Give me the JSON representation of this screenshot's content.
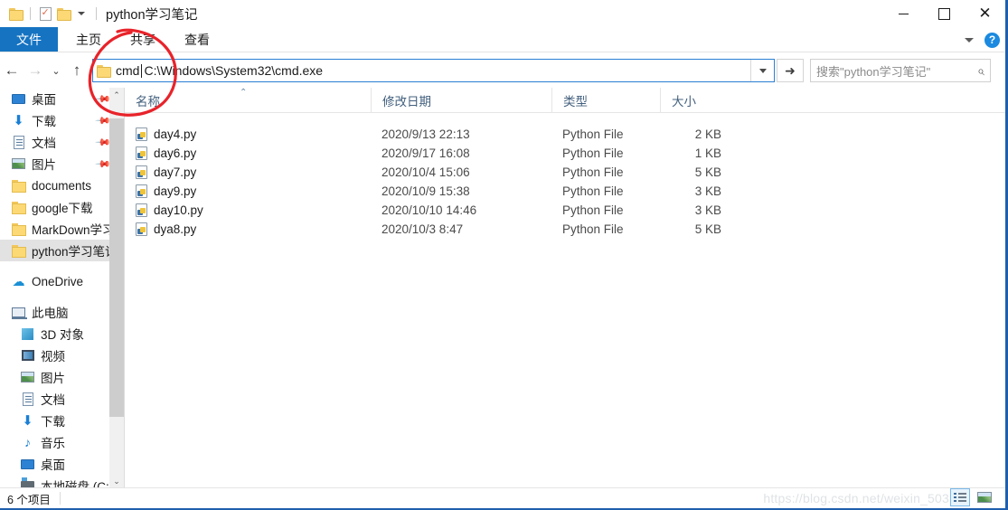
{
  "window": {
    "title": "python学习笔记",
    "quick_access": [
      {
        "name": "folder-icon",
        "label": "文件夹"
      },
      {
        "name": "properties-icon",
        "label": "属性"
      },
      {
        "name": "new-folder-icon",
        "label": "新建文件夹"
      },
      {
        "name": "chevron-down-icon",
        "label": "自定义快速访问工具栏"
      }
    ],
    "controls": {
      "minimize": "最小化",
      "maximize": "最大化",
      "close": "关闭"
    }
  },
  "ribbon": {
    "tabs": [
      {
        "label": "文件",
        "active": true
      },
      {
        "label": "主页",
        "active": false
      },
      {
        "label": "共享",
        "active": false
      },
      {
        "label": "查看",
        "active": false
      }
    ],
    "expand_label": "展开功能区",
    "help_label": "?"
  },
  "nav": {
    "back": "←",
    "forward": "→",
    "recent": "⌄",
    "up": "↑",
    "address": {
      "prefix": "cmd ",
      "value": "C:\\Windows\\System32\\cmd.exe",
      "dropdown": "⌄",
      "go": "➜"
    },
    "search": {
      "placeholder": "搜索\"python学习笔记\"",
      "icon": "⌕"
    }
  },
  "sidebar": {
    "quick_items": [
      {
        "label": "桌面",
        "icon": "desktop-icon",
        "pinned": true
      },
      {
        "label": "下载",
        "icon": "download-icon",
        "pinned": true
      },
      {
        "label": "文档",
        "icon": "document-icon",
        "pinned": true
      },
      {
        "label": "图片",
        "icon": "picture-icon",
        "pinned": true
      },
      {
        "label": "documents",
        "icon": "folder-icon",
        "pinned": false
      },
      {
        "label": "google下载",
        "icon": "folder-icon",
        "pinned": false
      },
      {
        "label": "MarkDown学习",
        "icon": "folder-icon",
        "pinned": false
      },
      {
        "label": "python学习笔记",
        "icon": "folder-icon",
        "pinned": false,
        "selected": true
      }
    ],
    "onedrive": {
      "label": "OneDrive",
      "icon": "cloud-icon"
    },
    "thispc": {
      "label": "此电脑",
      "icon": "pc-icon"
    },
    "pc_items": [
      {
        "label": "3D 对象",
        "icon": "cube-icon"
      },
      {
        "label": "视频",
        "icon": "video-icon"
      },
      {
        "label": "图片",
        "icon": "picture-icon"
      },
      {
        "label": "文档",
        "icon": "document-icon"
      },
      {
        "label": "下载",
        "icon": "download-icon"
      },
      {
        "label": "音乐",
        "icon": "music-icon"
      },
      {
        "label": "桌面",
        "icon": "desktop-icon"
      },
      {
        "label": "本地磁盘 (C:)",
        "icon": "disk-icon"
      }
    ],
    "scroll_up": "⌃",
    "scroll_down": "⌄"
  },
  "filelist": {
    "columns": [
      {
        "label": "名称",
        "sorted": "asc"
      },
      {
        "label": "修改日期"
      },
      {
        "label": "类型"
      },
      {
        "label": "大小"
      }
    ],
    "sort_indicator": "⌃",
    "rows": [
      {
        "name": "day4.py",
        "date": "2020/9/13 22:13",
        "type": "Python File",
        "size": "2 KB"
      },
      {
        "name": "day6.py",
        "date": "2020/9/17 16:08",
        "type": "Python File",
        "size": "1 KB"
      },
      {
        "name": "day7.py",
        "date": "2020/10/4 15:06",
        "type": "Python File",
        "size": "5 KB"
      },
      {
        "name": "day9.py",
        "date": "2020/10/9 15:38",
        "type": "Python File",
        "size": "3 KB"
      },
      {
        "name": "day10.py",
        "date": "2020/10/10 14:46",
        "type": "Python File",
        "size": "3 KB"
      },
      {
        "name": "dya8.py",
        "date": "2020/10/3 8:47",
        "type": "Python File",
        "size": "5 KB"
      }
    ]
  },
  "status": {
    "item_count": "6 个项目",
    "view_details": "详细信息",
    "view_large_icons": "大图标"
  },
  "watermark": "https://blog.csdn.net/weixin_503",
  "colors": {
    "accent": "#1573c2",
    "address_border": "#2a7fd4",
    "annotation": "#e8232a",
    "selection": "#e2e2e2"
  }
}
